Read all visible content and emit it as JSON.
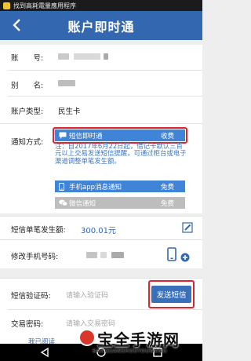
{
  "status_bar": {
    "app_text": "找到高耗電量應用程序"
  },
  "header": {
    "title": "账户即时通"
  },
  "account": {
    "account_label": "账　　号:",
    "name_label": "别　　名:",
    "type_label": "账户类型:",
    "type_value": "民生卡"
  },
  "notify": {
    "label": "通知方式:",
    "options": [
      {
        "name": "短信即时通",
        "price": "收费",
        "selected": true,
        "icon": "message-icon"
      },
      {
        "name": "手机app消息通知",
        "price": "免费",
        "selected": false,
        "icon": "phone-icon"
      },
      {
        "name": "微信通知",
        "price": "免费",
        "selected": false,
        "icon": "wechat-icon"
      }
    ],
    "notice": "注：自2017年6月22日起，借记卡默认三百元以上交易发送短信提醒，可通过柜台或电子渠道调整单笔发生额。"
  },
  "threshold": {
    "label": "短信单笔发生额:",
    "value": "300.01元"
  },
  "phone": {
    "label": "修改手机号码:"
  },
  "sms_code": {
    "label": "短信验证码:",
    "placeholder": "请输入验证码",
    "send_label": "发送短信"
  },
  "trade_password": {
    "label": "交易密码:",
    "placeholder": "请输入交易密码"
  },
  "footer": {
    "link_text": "我已阅读"
  },
  "watermark": {
    "text": "宝全手游网",
    "sub": "BAOQUANSHOUYOUWANG"
  },
  "colors": {
    "brand_blue": "#3367b0",
    "highlight_red": "#e0242f",
    "option_blue": "#3f84d6",
    "option_gray": "#bdbdbd",
    "notice_blue": "#3f78c2"
  }
}
